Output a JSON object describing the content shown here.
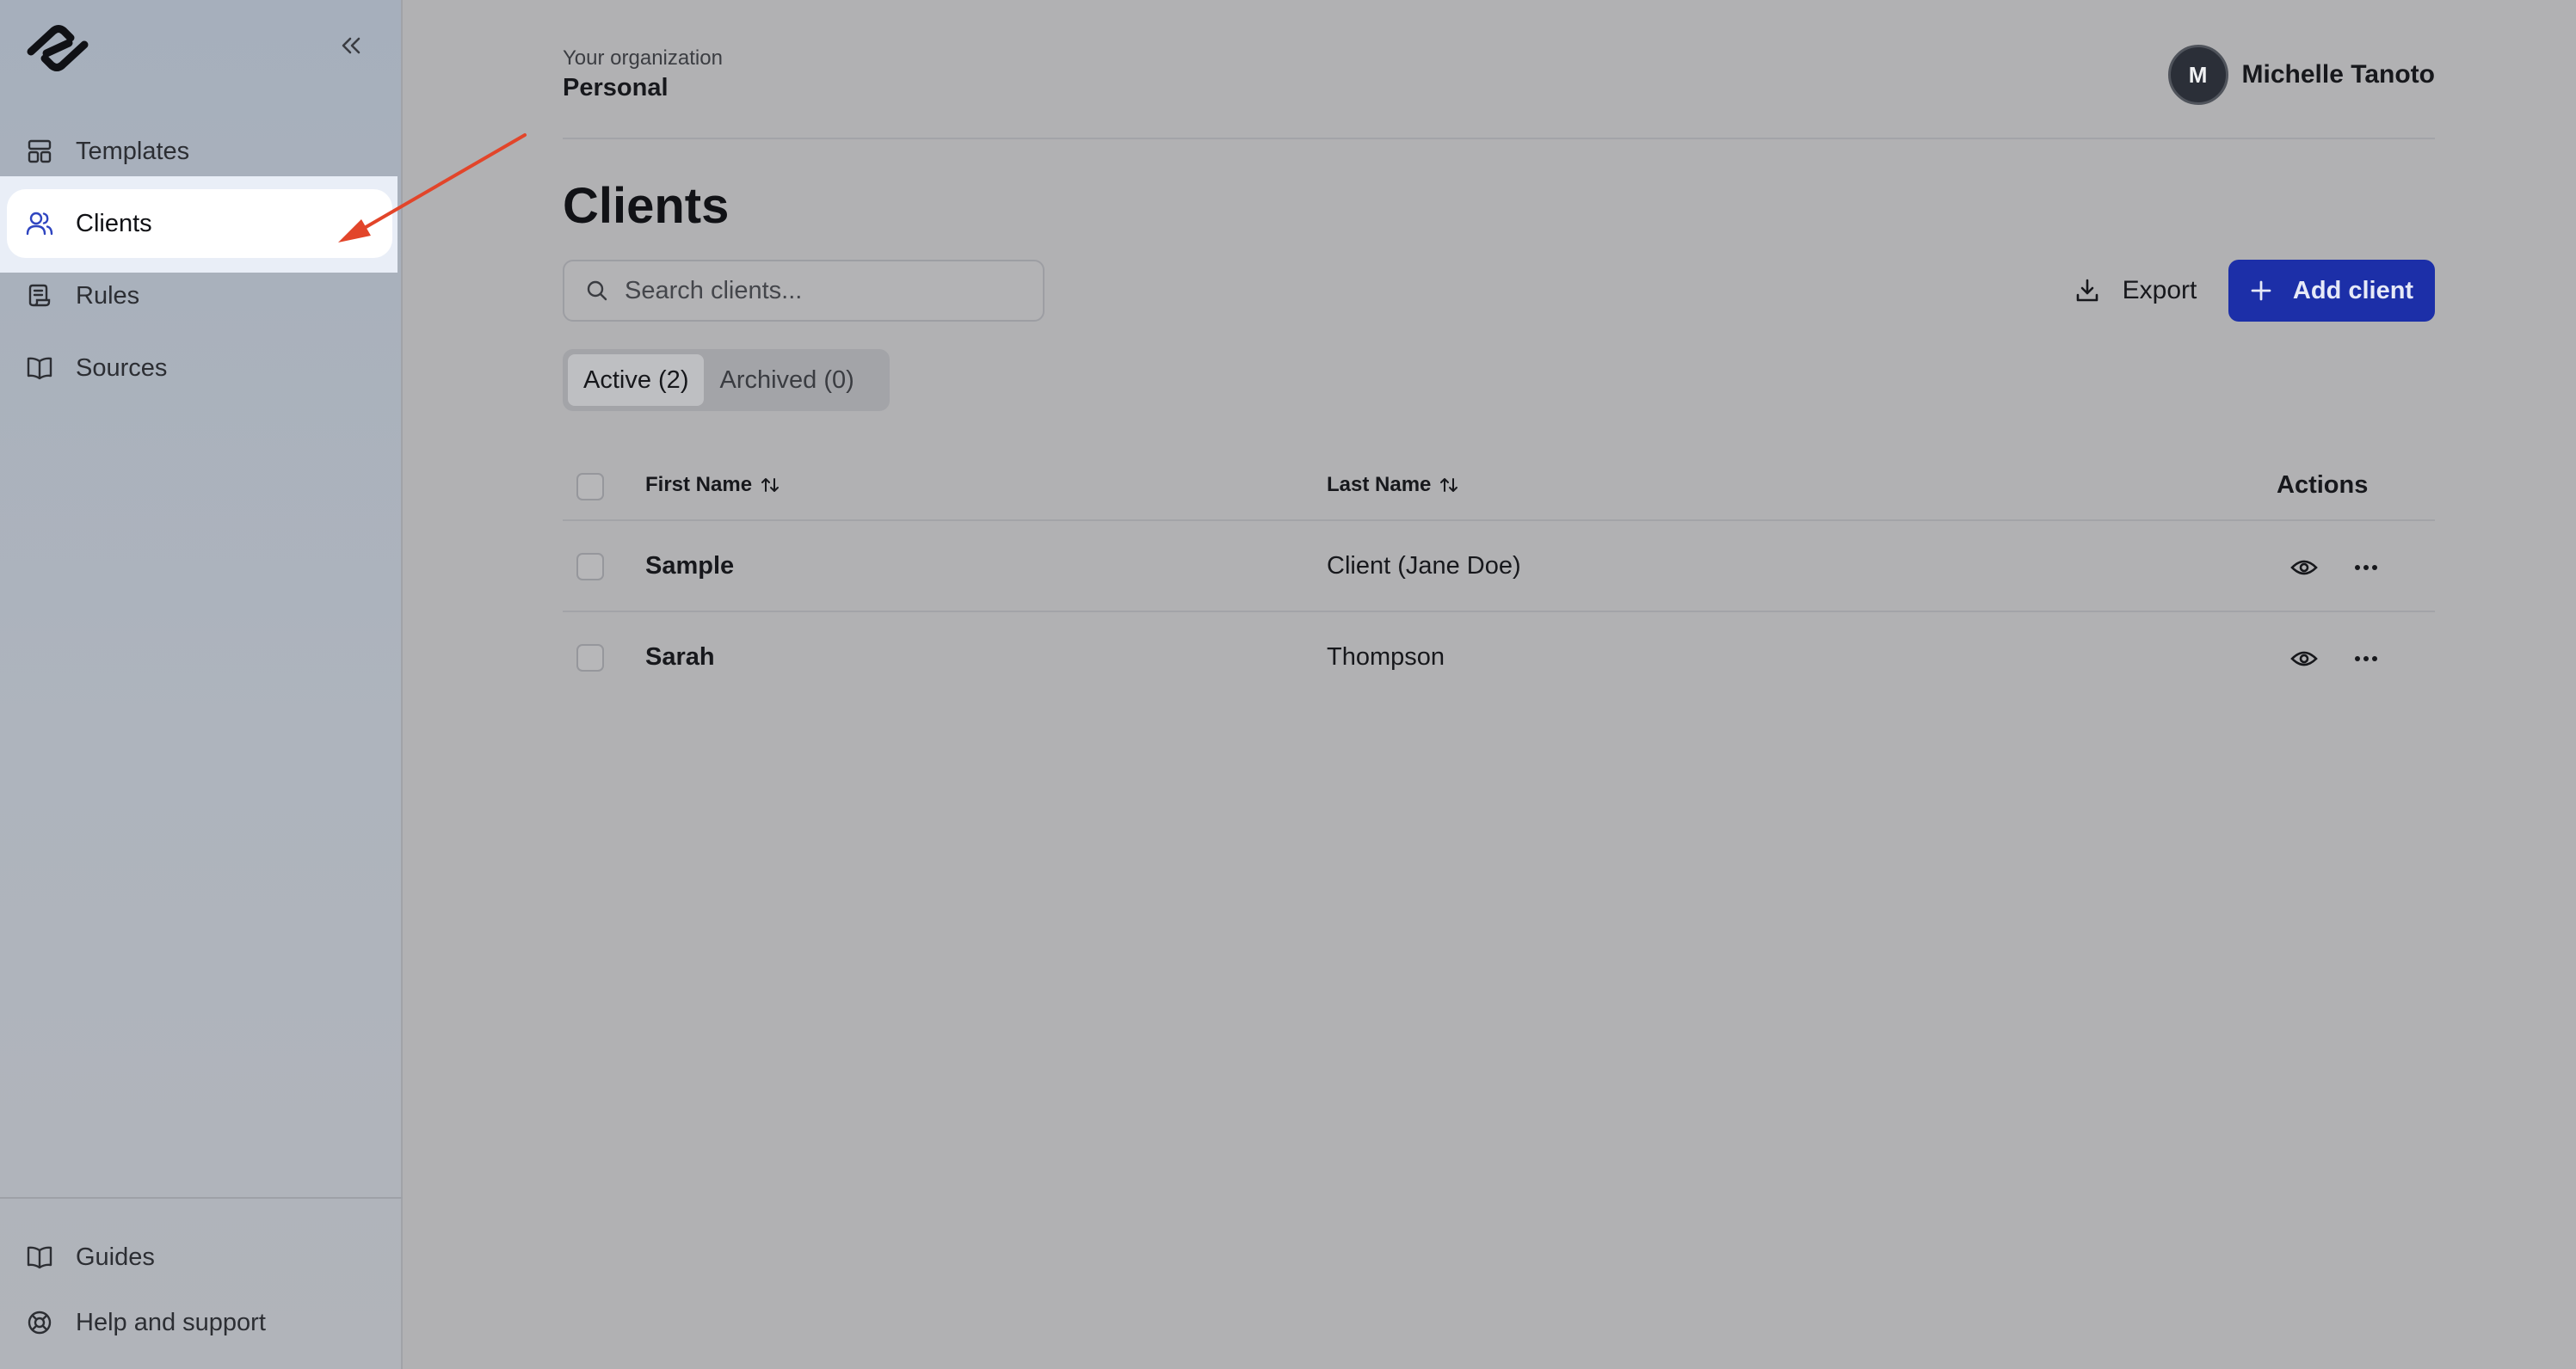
{
  "sidebar": {
    "logo": "app-logo",
    "collapse_icon": "chevrons-left-icon",
    "items": [
      {
        "label": "Templates",
        "icon": "layout-icon"
      },
      {
        "label": "Clients",
        "icon": "users-icon",
        "active": true
      },
      {
        "label": "Rules",
        "icon": "scroll-icon"
      },
      {
        "label": "Sources",
        "icon": "book-open-icon"
      }
    ],
    "footer_items": [
      {
        "label": "Guides",
        "icon": "book-open-icon"
      },
      {
        "label": "Help and support",
        "icon": "life-buoy-icon"
      }
    ]
  },
  "header": {
    "org_caption": "Your organization",
    "org_name": "Personal",
    "user": {
      "initial": "M",
      "name": "Michelle Tanoto"
    }
  },
  "page": {
    "title": "Clients",
    "search_placeholder": "Search clients...",
    "export_label": "Export",
    "add_label": "Add client",
    "tabs": [
      {
        "label": "Active (2)",
        "active": true
      },
      {
        "label": "Archived (0)",
        "active": false
      }
    ]
  },
  "table": {
    "columns": {
      "first_name": "First Name",
      "last_name": "Last Name",
      "actions": "Actions"
    },
    "rows": [
      {
        "first_name": "Sample",
        "last_name": "Client (Jane Doe)"
      },
      {
        "first_name": "Sarah",
        "last_name": "Thompson"
      }
    ]
  },
  "colors": {
    "primary_button": "#1c2fa8",
    "annotation_arrow": "#e2452a",
    "highlight": "#e9eef7"
  }
}
